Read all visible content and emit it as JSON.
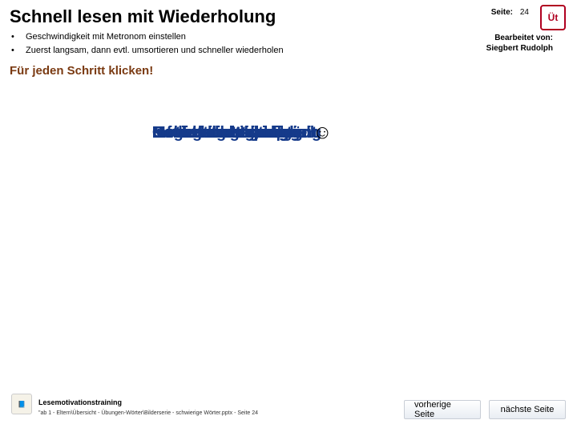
{
  "header": {
    "title": "Schnell lesen mit Wiederholung",
    "page_label": "Seite:",
    "page_number": "24",
    "logo_text": "Üt"
  },
  "bullets": [
    "Geschwindigkeit mit Metronom einstellen",
    "Zuerst langsam, dann evtl. umsortieren und schneller wiederholen"
  ],
  "edited_by": {
    "label": "Bearbeitet von:",
    "name": "Siegbert Rudolph"
  },
  "subtitle": "Für jeden Schritt klicken!",
  "stacked_words": [
    "Betriebsgenehmigung",
    "Rechtschreibproblem",
    "Gegendarstellung",
    "Gehaltsabrechnung",
    "Naturschutzgebiet",
    "Bewerbungsgespräch",
    "Bedarfshaltestelle",
    "Informationsmaterial",
    "Hochgeschwindigkeit",
    "Benachrichtigung",
    "Motivationstraining"
  ],
  "smiley": "☺",
  "footer": {
    "title": "Lesemotivationstraining",
    "path": "\"ab 1 - Eltern\\Übersicht - Übungen-Wörter\\Bilderserie - schwierige Wörter.pptx - Seite 24",
    "logo_placeholder": "📘"
  },
  "nav": {
    "prev": "vorherige Seite",
    "next": "nächste Seite"
  }
}
